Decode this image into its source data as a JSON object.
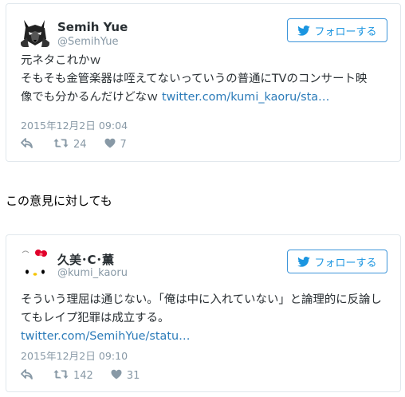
{
  "colors": {
    "border": "#e1e8ed",
    "link": "#2b7bb9",
    "muted": "#8899a6",
    "follow_blue": "#1b95e0"
  },
  "tweets": [
    {
      "name": "Semih Yue",
      "handle": "@SemihYue",
      "follow_label": "フォローする",
      "lines": [
        "元ネタこれかｗ",
        "そもそも金管楽器は咥えてないっていうの普通にTVのコンサート映"
      ],
      "last_line_text": "像でも分かるんだけどなｗ",
      "link": "twitter.com/kumi_kaoru/sta…",
      "timestamp": "2015年12月2日 09:04",
      "retweets": "24",
      "likes": "7",
      "icons": {
        "avatar": "wolf-avatar",
        "reply": "reply-icon",
        "retweet": "retweet-icon",
        "like": "heart-icon",
        "bird": "twitter-bird-icon"
      }
    },
    {
      "name": "久美･C･薫",
      "handle": "@kumi_kaoru",
      "follow_label": "フォローする",
      "lines": [
        "そういう理屈は通じない。「俺は中に入れていない」と論理的に反論し",
        "てもレイプ犯罪は成立する。"
      ],
      "last_line_text": "",
      "link": "twitter.com/SemihYue/statu…",
      "timestamp": "2015年12月2日 09:10",
      "retweets": "142",
      "likes": "31",
      "icons": {
        "avatar": "hello-kitty-avatar",
        "reply": "reply-icon",
        "retweet": "retweet-icon",
        "like": "heart-icon",
        "bird": "twitter-bird-icon"
      }
    }
  ],
  "between_text": "この意見に対しても"
}
